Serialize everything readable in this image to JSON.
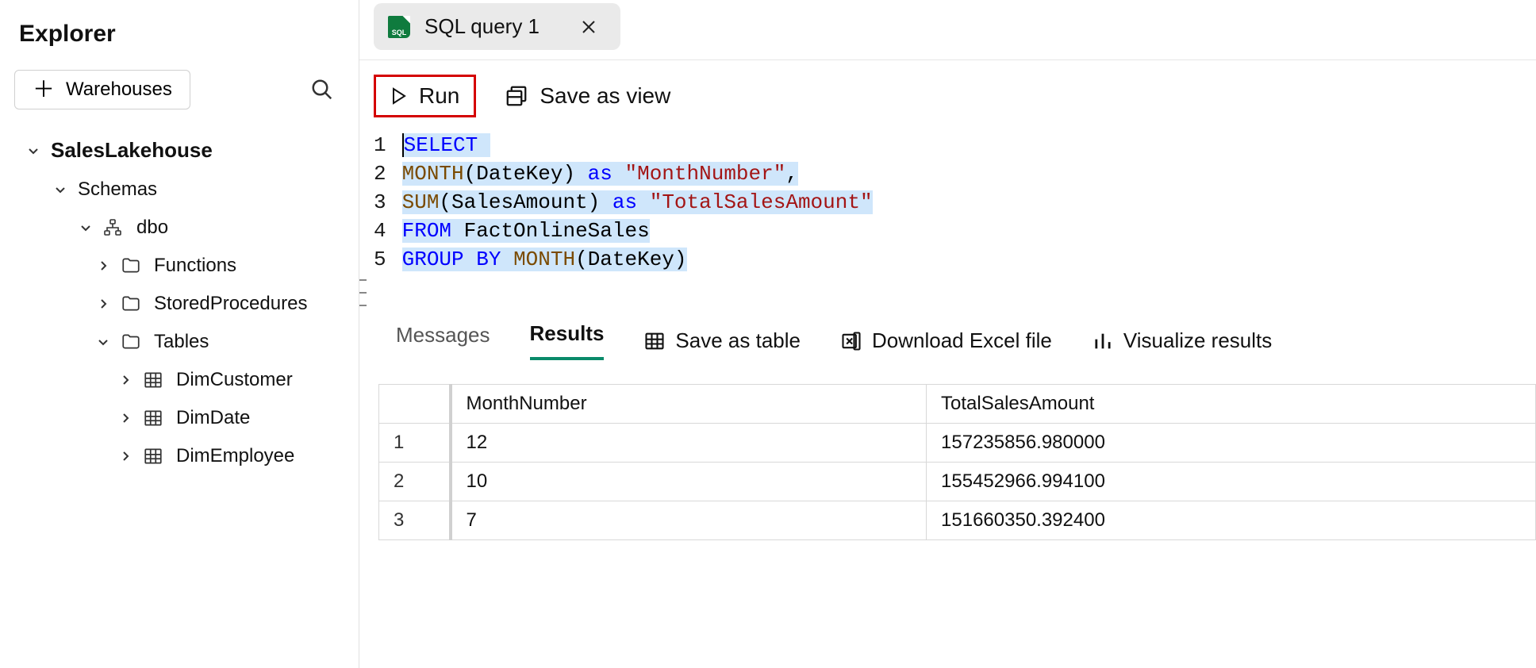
{
  "sidebar": {
    "title": "Explorer",
    "warehouses_button": "Warehouses",
    "tree": {
      "lakehouse": "SalesLakehouse",
      "schemas_label": "Schemas",
      "schema": "dbo",
      "functions": "Functions",
      "stored_procs": "StoredProcedures",
      "tables_label": "Tables",
      "tables": [
        "DimCustomer",
        "DimDate",
        "DimEmployee"
      ]
    }
  },
  "tab": {
    "label": "SQL query 1",
    "badge": "SQL"
  },
  "toolbar": {
    "run": "Run",
    "save_view": "Save as view"
  },
  "editor": {
    "line_numbers": [
      "1",
      "2",
      "3",
      "4",
      "5"
    ],
    "code": {
      "l1": {
        "select": "SELECT"
      },
      "l2": {
        "fn": "MONTH",
        "open": "(",
        "arg": "DateKey",
        "close": ")",
        "as": "as",
        "str": "\"MonthNumber\"",
        "comma": ","
      },
      "l3": {
        "fn": "SUM",
        "open": "(",
        "arg": "SalesAmount",
        "close": ")",
        "as": "as",
        "str": "\"TotalSalesAmount\""
      },
      "l4": {
        "from": "FROM",
        "id": "FactOnlineSales"
      },
      "l5": {
        "group": "GROUP",
        "by": "BY",
        "fn": "MONTH",
        "open": "(",
        "arg": "DateKey",
        "close": ")"
      }
    }
  },
  "results": {
    "messages_tab": "Messages",
    "results_tab": "Results",
    "save_table": "Save as table",
    "download_excel": "Download Excel file",
    "visualize": "Visualize results",
    "columns": [
      "MonthNumber",
      "TotalSalesAmount"
    ],
    "rows": [
      {
        "n": "1",
        "c0": "12",
        "c1": "157235856.980000"
      },
      {
        "n": "2",
        "c0": "10",
        "c1": "155452966.994100"
      },
      {
        "n": "3",
        "c0": "7",
        "c1": "151660350.392400"
      }
    ]
  }
}
